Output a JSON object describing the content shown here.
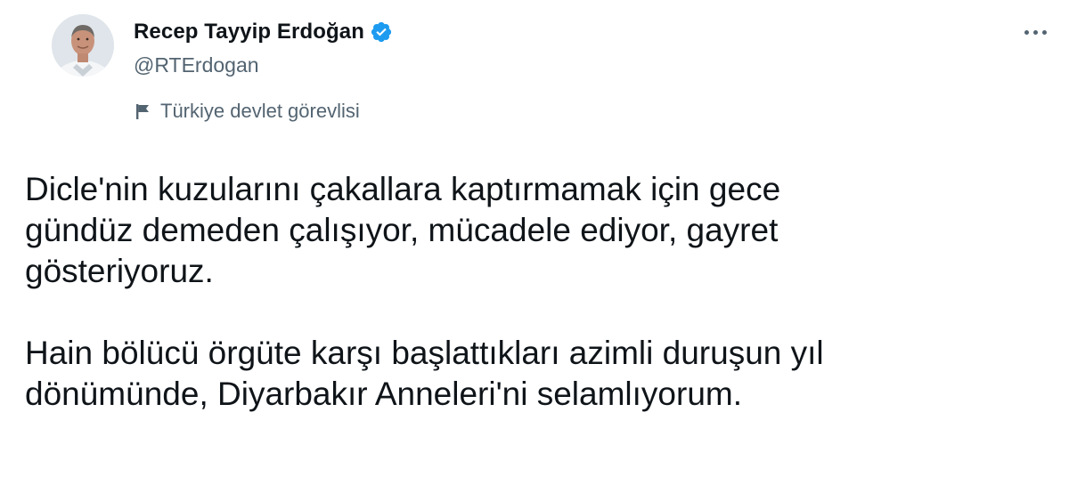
{
  "author": {
    "display_name": "Recep Tayyip Erdoğan",
    "handle": "@RTErdogan",
    "label": "Türkiye devlet görevlisi",
    "verified": true
  },
  "icons": {
    "verified": "verified-badge-icon",
    "label": "flag-icon",
    "more": "more-options-icon"
  },
  "colors": {
    "verified_blue": "#1d9bf0",
    "secondary_text": "#536471",
    "primary_text": "#0f1419"
  },
  "tweet": {
    "paragraph1": [
      "Dicle'nin kuzularını çakallara kaptırmamak için gece",
      "gündüz demeden çalışıyor, mücadele ediyor, gayret",
      "gösteriyoruz."
    ],
    "paragraph2": [
      "Hain bölücü örgüte karşı başlattıkları azimli duruşun yıl",
      "dönümünde, Diyarbakır Anneleri'ni selamlıyorum."
    ]
  }
}
